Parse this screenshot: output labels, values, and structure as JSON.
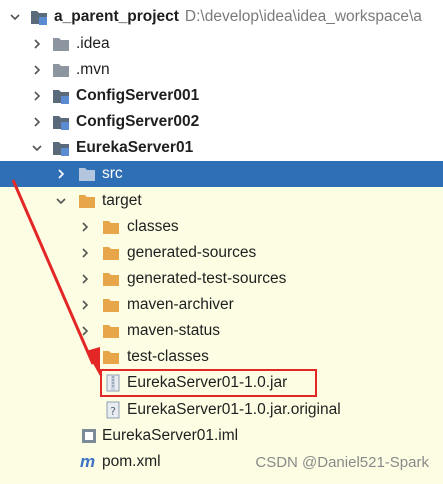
{
  "project": {
    "name": "a_parent_project",
    "path": "D:\\develop\\idea\\idea_workspace\\a"
  },
  "tree": {
    "idea": ".idea",
    "mvn": ".mvn",
    "config1": "ConfigServer001",
    "config2": "ConfigServer002",
    "eureka": "EurekaServer01",
    "src": "src",
    "target": "target",
    "classes": "classes",
    "gen_src": "generated-sources",
    "gen_test_src": "generated-test-sources",
    "mvn_archiver": "maven-archiver",
    "mvn_status": "maven-status",
    "test_classes": "test-classes",
    "jar": "EurekaServer01-1.0.jar",
    "jar_original": "EurekaServer01-1.0.jar.original",
    "iml": "EurekaServer01.iml",
    "pom": "pom.xml"
  },
  "watermark": "CSDN @Daniel521-Spark",
  "colors": {
    "selection": "#2f6fb5",
    "folder": "#8c95a0",
    "module_folder": "#5b6a7b",
    "target_folder": "#e8a64a",
    "annotation_red": "#e32626"
  }
}
